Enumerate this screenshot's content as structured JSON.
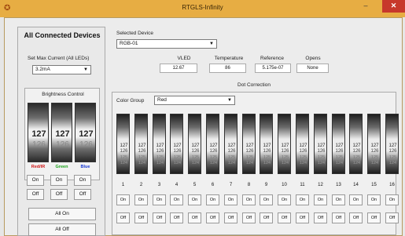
{
  "window": {
    "title": "RTGLS-Infinity",
    "min_label": "‒",
    "max_label": "□",
    "close_label": "✕"
  },
  "left": {
    "heading": "All Connected Devices",
    "max_current_label": "Set Max Current (All LEDs)",
    "max_current_value": "3.2mA",
    "brightness_title": "Brightness Control",
    "wheels": [
      {
        "value": "127",
        "next": "126",
        "label": "Red/IR",
        "color": "#d01818"
      },
      {
        "value": "127",
        "next": "126",
        "label": "Green",
        "color": "#18a018"
      },
      {
        "value": "127",
        "next": "126",
        "label": "Blue",
        "color": "#1838d0"
      }
    ],
    "on_label": "On",
    "off_label": "Off",
    "all_on_label": "All On",
    "all_off_label": "All Off"
  },
  "device": {
    "selected_label": "Selected Device",
    "selected_value": "RGB-01"
  },
  "readouts": [
    {
      "label": "VLED",
      "value": "12.67"
    },
    {
      "label": "Temperature",
      "value": "86"
    },
    {
      "label": "Reference",
      "value": "5.175e-07"
    },
    {
      "label": "Opens",
      "value": "None"
    }
  ],
  "dot_correction": {
    "title": "Dot Correction",
    "color_group_label": "Color Group",
    "color_group_value": "Red",
    "values": [
      "127",
      "126",
      "125",
      "124"
    ],
    "columns": [
      "1",
      "2",
      "3",
      "4",
      "5",
      "6",
      "7",
      "8",
      "9",
      "10",
      "11",
      "12",
      "13",
      "14",
      "15",
      "16"
    ],
    "on_label": "On",
    "off_label": "Off"
  }
}
